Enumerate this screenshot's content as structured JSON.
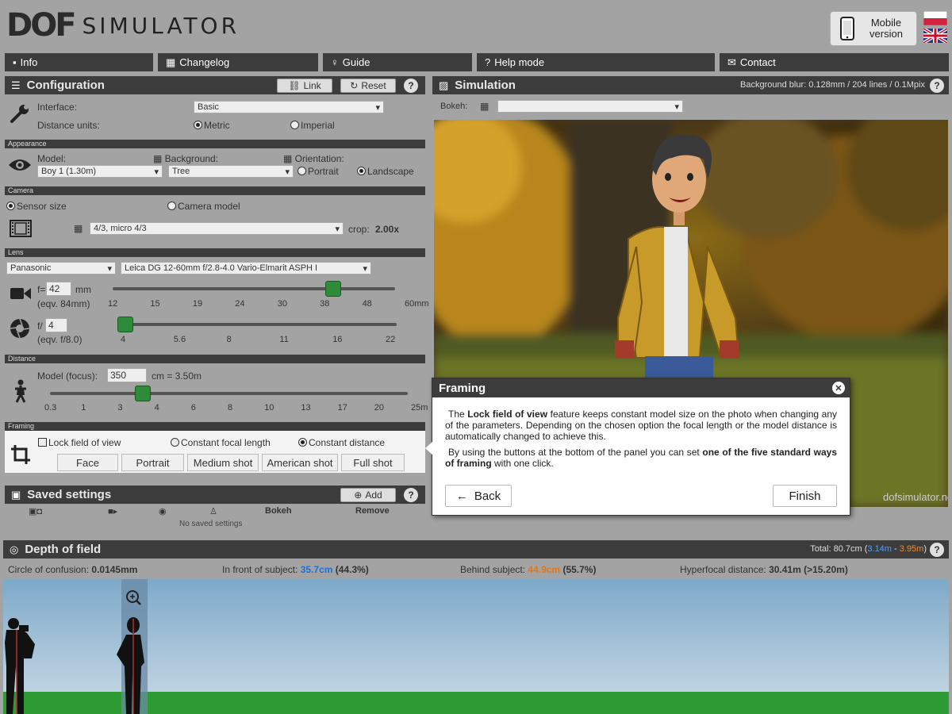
{
  "app": {
    "logo_dof": "DOF",
    "logo_simulator": "SIMULATOR",
    "mobile_label": "Mobile version"
  },
  "nav": [
    "Info",
    "Changelog",
    "Guide",
    "Help mode",
    "Contact"
  ],
  "config": {
    "title": "Configuration",
    "link": "Link",
    "reset": "Reset",
    "help": "?",
    "interface_label": "Interface:",
    "interface_value": "Basic",
    "units_label": "Distance units:",
    "metric": "Metric",
    "imperial": "Imperial",
    "appearance_title": "Appearance",
    "model_label": "Model:",
    "model_value": "Boy 1 (1.30m)",
    "background_label": "Background:",
    "background_value": "Tree",
    "orientation_label": "Orientation:",
    "portrait": "Portrait",
    "landscape": "Landscape",
    "camera_title": "Camera",
    "sensor_size": "Sensor size",
    "camera_model": "Camera model",
    "sensor_value": "4/3, micro 4/3",
    "crop_label": "crop:",
    "crop_value": "2.00x",
    "lens_title": "Lens",
    "lens_brand": "Panasonic",
    "lens_model": "Leica DG 12-60mm f/2.8-4.0 Vario-Elmarit ASPH I",
    "focal_prefix": "f=",
    "focal_value": "42",
    "focal_unit": "mm",
    "focal_eqv": "(eqv. 84mm)",
    "focal_ticks": [
      "12",
      "15",
      "19",
      "24",
      "30",
      "38",
      "48",
      "60mm"
    ],
    "focal_slider": 0.78,
    "aperture_prefix": "f/",
    "aperture_value": "4",
    "aperture_eqv": "(eqv. f/8.0)",
    "aperture_ticks": [
      "4",
      "5.6",
      "8",
      "11",
      "16",
      "22"
    ],
    "aperture_slider": 0.0,
    "distance_title": "Distance",
    "focus_label": "Model (focus):",
    "focus_value": "350",
    "focus_unit": "cm = 3.50m",
    "distance_ticks": [
      "0.3",
      "1",
      "3",
      "4",
      "6",
      "8",
      "10",
      "13",
      "17",
      "20",
      "25m"
    ],
    "distance_slider": 0.26,
    "framing_title": "Framing",
    "lock_fov": "Lock field of view",
    "const_focal": "Constant focal length",
    "const_distance": "Constant distance",
    "framing_buttons": [
      "Face",
      "Portrait",
      "Medium shot",
      "American shot",
      "Full shot"
    ]
  },
  "saved": {
    "title": "Saved settings",
    "add": "Add",
    "bokeh_col": "Bokeh",
    "remove_col": "Remove",
    "empty": "No saved settings"
  },
  "simulation": {
    "title": "Simulation",
    "blur_info": "Background blur: 0.128mm / 204 lines / 0.1Mpix",
    "bokeh_label": "Bokeh:",
    "watermark": "dofsimulator.net"
  },
  "popup": {
    "title": "Framing",
    "p1_a": "The ",
    "p1_b": "Lock field of view",
    "p1_c": " feature keeps constant model size on the photo when changing any of the parameters. Depending on the chosen option the focal length or the model distance is automatically changed to achieve this.",
    "p2_a": "By using the buttons at the bottom of the panel you can set ",
    "p2_b": "one of the five standard ways of framing",
    "p2_c": " with one click.",
    "back": "Back",
    "finish": "Finish"
  },
  "dof": {
    "title": "Depth of field",
    "total_label": "Total:",
    "total_value": "80.7cm",
    "near": "3.14m",
    "dash": " - ",
    "far": "3.95m",
    "coc_label": "Circle of confusion:",
    "coc_value": "0.0145mm",
    "front_label": "In front of subject:",
    "front_value": "35.7cm",
    "front_pct": "(44.3%)",
    "behind_label": "Behind subject:",
    "behind_value": "44.9cm",
    "behind_pct": "(55.7%)",
    "hyper_label": "Hyperfocal distance:",
    "hyper_value": "30.41m (>15.20m)"
  },
  "colors": {
    "accent_blue": "#1e6fd9",
    "accent_orange": "#e0761a",
    "knob_green": "#2e8b3a",
    "header_dark": "#3c3c3c"
  }
}
